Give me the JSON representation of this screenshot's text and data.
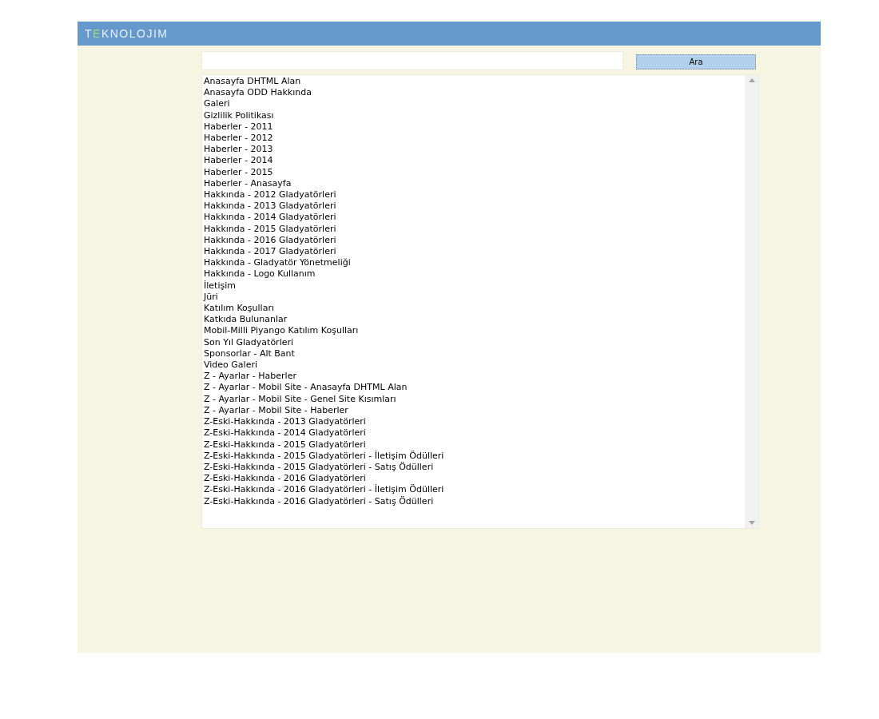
{
  "logo": {
    "parts": [
      {
        "text": "T",
        "accent": false
      },
      {
        "text": "E",
        "accent": true
      },
      {
        "text": "KNOLOJIM",
        "accent": false
      }
    ]
  },
  "search": {
    "button": "Ara"
  },
  "list": {
    "items": [
      "Anasayfa DHTML Alan",
      "Anasayfa ODD Hakkında",
      "Galeri",
      "Gizlilik Politikası",
      "Haberler - 2011",
      "Haberler - 2012",
      "Haberler - 2013",
      "Haberler - 2014",
      "Haberler - 2015",
      "Haberler - Anasayfa",
      "Hakkında - 2012 Gladyatörleri",
      "Hakkında - 2013 Gladyatörleri",
      "Hakkında - 2014 Gladyatörleri",
      "Hakkında - 2015 Gladyatörleri",
      "Hakkında - 2016 Gladyatörleri",
      "Hakkında - 2017 Gladyatörleri",
      "Hakkında - Gladyatör Yönetmeliği",
      "Hakkında - Logo Kullanım",
      "İletişim",
      "Jüri",
      "Katılım Koşulları",
      "Katkıda Bulunanlar",
      "Mobil-Milli Piyango Katılım Koşulları",
      "Son Yıl Gladyatörleri",
      "Sponsorlar - Alt Bant",
      "Video Galeri",
      "Z - Ayarlar - Haberler",
      "Z - Ayarlar - Mobil Site - Anasayfa DHTML Alan",
      "Z - Ayarlar - Mobil Site - Genel Site Kısımları",
      "Z - Ayarlar - Mobil Site - Haberler",
      "Z-Eski-Hakkında - 2013 Gladyatörleri",
      "Z-Eski-Hakkında - 2014 Gladyatörleri",
      "Z-Eski-Hakkında - 2015 Gladyatörleri",
      "Z-Eski-Hakkında - 2015 Gladyatörleri - İletişim Ödülleri",
      "Z-Eski-Hakkında - 2015 Gladyatörleri - Satış Ödülleri",
      "Z-Eski-Hakkında - 2016 Gladyatörleri",
      "Z-Eski-Hakkında - 2016 Gladyatörleri - İletişim Ödülleri",
      "Z-Eski-Hakkında - 2016 Gladyatörleri - Satış Ödülleri"
    ]
  }
}
